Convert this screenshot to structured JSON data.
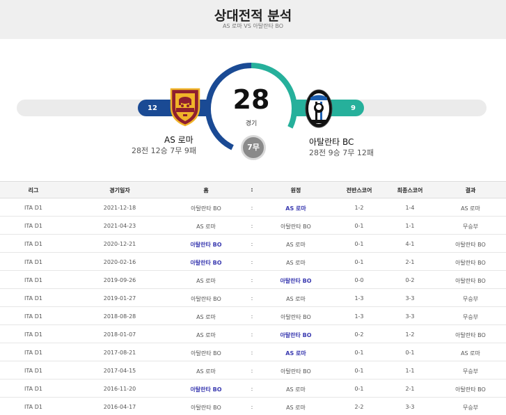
{
  "header": {
    "title": "상대전적 분석",
    "subtitle": "AS 로마 VS 아탈란타 BO"
  },
  "summary": {
    "total_games": "28",
    "games_label": "경기",
    "draws_label": "7무",
    "home": {
      "name": "AS 로마",
      "wins": "12",
      "record": "28전 12승 7무 9패",
      "color": "#1a4a94"
    },
    "away": {
      "name": "아탈란타 BC",
      "wins": "9",
      "record": "28전 9승 7무 12패",
      "color": "#26b09b"
    },
    "draw_color": "#8a8a8a",
    "home_share": 0.4286,
    "away_share": 0.3214
  },
  "table": {
    "headers": {
      "league": "리그",
      "date": "경기일자",
      "home": "홈",
      "sep": ":",
      "away": "원정",
      "half": "전반스코어",
      "final": "최종스코어",
      "result": "결과"
    },
    "rows": [
      {
        "league": "ITA D1",
        "date": "2021-12-18",
        "home": "아탈란타 BO",
        "sep": ":",
        "away": "AS 로마",
        "half": "1-2",
        "final": "1-4",
        "result": "AS 로마",
        "winner": "away"
      },
      {
        "league": "ITA D1",
        "date": "2021-04-23",
        "home": "AS 로마",
        "sep": ":",
        "away": "아탈란타 BO",
        "half": "0-1",
        "final": "1-1",
        "result": "무승부",
        "winner": "none"
      },
      {
        "league": "ITA D1",
        "date": "2020-12-21",
        "home": "아탈란타 BO",
        "sep": ":",
        "away": "AS 로마",
        "half": "0-1",
        "final": "4-1",
        "result": "아탈란타 BO",
        "winner": "home"
      },
      {
        "league": "ITA D1",
        "date": "2020-02-16",
        "home": "아탈란타 BO",
        "sep": ":",
        "away": "AS 로마",
        "half": "0-1",
        "final": "2-1",
        "result": "아탈란타 BO",
        "winner": "home"
      },
      {
        "league": "ITA D1",
        "date": "2019-09-26",
        "home": "AS 로마",
        "sep": ":",
        "away": "아탈란타 BO",
        "half": "0-0",
        "final": "0-2",
        "result": "아탈란타 BO",
        "winner": "away"
      },
      {
        "league": "ITA D1",
        "date": "2019-01-27",
        "home": "아탈란타 BO",
        "sep": ":",
        "away": "AS 로마",
        "half": "1-3",
        "final": "3-3",
        "result": "무승부",
        "winner": "none"
      },
      {
        "league": "ITA D1",
        "date": "2018-08-28",
        "home": "AS 로마",
        "sep": ":",
        "away": "아탈란타 BO",
        "half": "1-3",
        "final": "3-3",
        "result": "무승부",
        "winner": "none"
      },
      {
        "league": "ITA D1",
        "date": "2018-01-07",
        "home": "AS 로마",
        "sep": ":",
        "away": "아탈란타 BO",
        "half": "0-2",
        "final": "1-2",
        "result": "아탈란타 BO",
        "winner": "away"
      },
      {
        "league": "ITA D1",
        "date": "2017-08-21",
        "home": "아탈란타 BO",
        "sep": ":",
        "away": "AS 로마",
        "half": "0-1",
        "final": "0-1",
        "result": "AS 로마",
        "winner": "away"
      },
      {
        "league": "ITA D1",
        "date": "2017-04-15",
        "home": "AS 로마",
        "sep": ":",
        "away": "아탈란타 BO",
        "half": "0-1",
        "final": "1-1",
        "result": "무승부",
        "winner": "none"
      },
      {
        "league": "ITA D1",
        "date": "2016-11-20",
        "home": "아탈란타 BO",
        "sep": ":",
        "away": "AS 로마",
        "half": "0-1",
        "final": "2-1",
        "result": "아탈란타 BO",
        "winner": "home"
      },
      {
        "league": "ITA D1",
        "date": "2016-04-17",
        "home": "아탈란타 BO",
        "sep": ":",
        "away": "AS 로마",
        "half": "2-2",
        "final": "3-3",
        "result": "무승부",
        "winner": "none"
      }
    ]
  }
}
